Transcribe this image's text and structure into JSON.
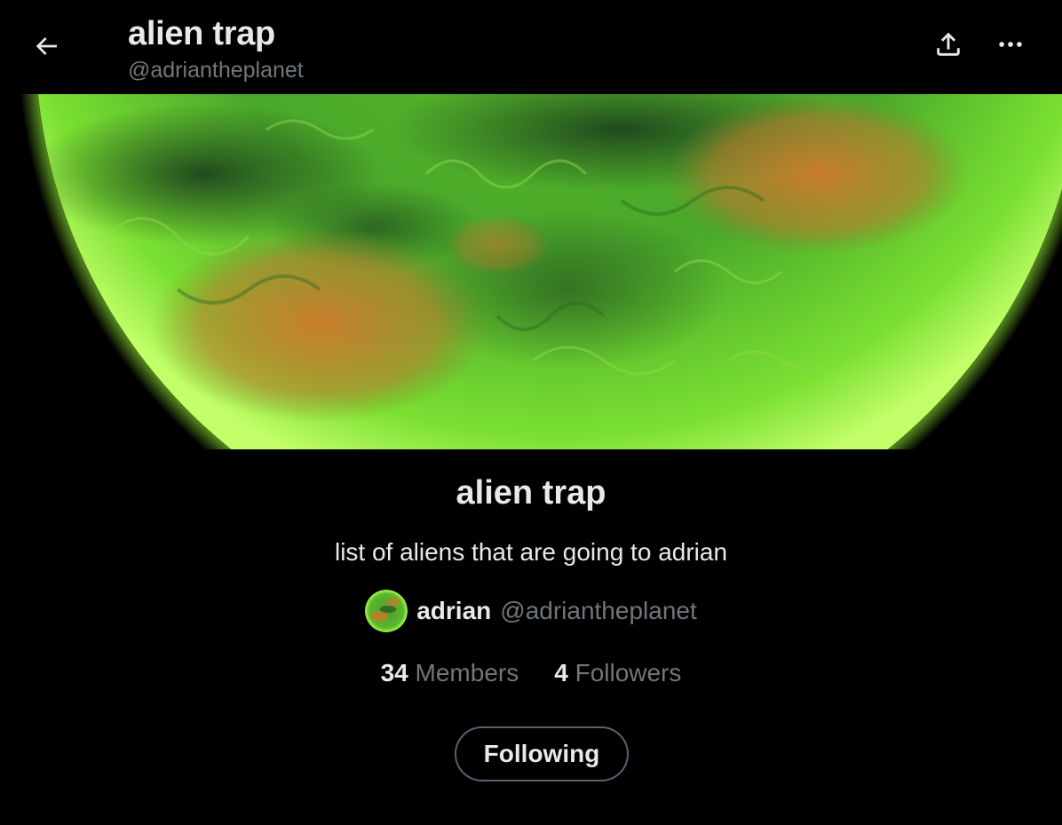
{
  "header": {
    "title": "alien trap",
    "handle": "@adriantheplanet",
    "back_icon": "arrow-left-icon",
    "share_icon": "share-upload-icon",
    "more_icon": "more-horizontal-icon"
  },
  "banner": {
    "description": "green planet banner image",
    "colors": {
      "planet_base": "#3fae1a",
      "planet_glow": "#9cff3a",
      "planet_dark": "#1f4a1a",
      "orange_patch": "#c67a2c"
    }
  },
  "list": {
    "name": "alien trap",
    "description": "list of aliens that are going to adrian"
  },
  "owner": {
    "name": "adrian",
    "handle": "@adriantheplanet"
  },
  "stats": {
    "members_count": "34",
    "members_label": "Members",
    "followers_count": "4",
    "followers_label": "Followers"
  },
  "actions": {
    "following_label": "Following"
  },
  "colors": {
    "background": "#000000",
    "text_primary": "#e7e9ea",
    "text_secondary": "#71767b",
    "button_border": "#536471"
  }
}
